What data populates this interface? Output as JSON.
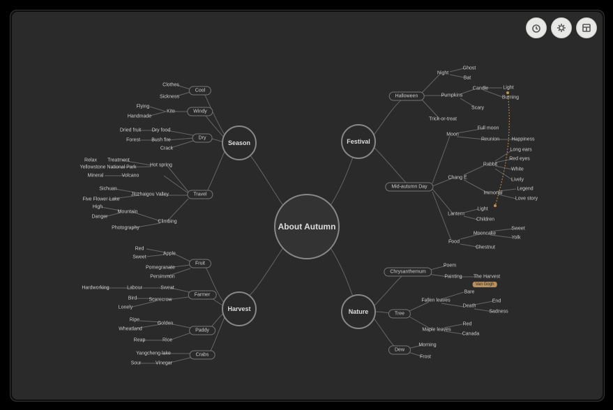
{
  "center": "About Autumn",
  "toolbar": {
    "timer": "timer-icon",
    "theme": "sun-icon",
    "layout": "layout-icon"
  },
  "branches": {
    "season": {
      "label": "Season",
      "children": {
        "cool": {
          "label": "Cool",
          "items": {
            "clothes": "Clothes",
            "sickness": "Sickness"
          }
        },
        "windy": {
          "label": "Windy",
          "items": {
            "kite": "Kite",
            "flying": "Flying",
            "handmade": "Handmade"
          }
        },
        "dry": {
          "label": "Dry",
          "items": {
            "dryfood": "Dry food",
            "driedfruit": "Dried fruit",
            "bushfire": "Bush fire",
            "forest": "Forest",
            "crack": "Crack"
          }
        },
        "travel": {
          "label": "Travel",
          "items": {
            "hotspring": "Hot spring",
            "relax": "Relax",
            "treatment": "Treatment",
            "yellowstone": "Yellowstone National Park",
            "volcano": "Volcano",
            "mineral": "Mineral",
            "jiuzhaigou": "Jiuzhaigou Valley",
            "sichuan": "Sichuan",
            "fiveflower": "Five Flower Lake",
            "climbing": "Climbing",
            "mountain": "Mountain",
            "high": "High",
            "danger": "Danger",
            "photography": "Photography"
          }
        }
      }
    },
    "harvest": {
      "label": "Harvest",
      "children": {
        "fruit": {
          "label": "Fruit",
          "items": {
            "apple": "Apple",
            "red": "Red",
            "sweet": "Sweet",
            "pomegranate": "Pomegranate",
            "persimmon": "Persimmon"
          }
        },
        "farmer": {
          "label": "Farmer",
          "items": {
            "sweat": "Sweat",
            "labour": "Labour",
            "hardworking": "Hardworking",
            "scarecrow": "Scarecrow",
            "bird": "Bird",
            "lonely": "Lonely"
          }
        },
        "paddy": {
          "label": "Paddy",
          "items": {
            "golden": "Golden",
            "ripe": "Ripe",
            "wheatland": "Wheatland",
            "rice": "Rice",
            "reap": "Reap"
          }
        },
        "crabs": {
          "label": "Crabs",
          "items": {
            "yangcheng": "Yangcheng lake",
            "vinegar": "Vinegar",
            "sour": "Sour"
          }
        }
      }
    },
    "festival": {
      "label": "Festival",
      "children": {
        "halloween": {
          "label": "Halloween",
          "items": {
            "night": "Night",
            "ghost": "Ghost",
            "bat": "Bat",
            "pumpkins": "Pumpkins",
            "candle": "Candle",
            "light": "Light",
            "burning": "Burning",
            "scary": "Scary",
            "trickortreat": "Trick-or-treat"
          }
        },
        "midautumn": {
          "label": "Mid-autumn Day",
          "items": {
            "moon": "Moon",
            "fullmoon": "Full moon",
            "reunion": "Reunion",
            "happiness": "Happiness",
            "change": "Chang E",
            "rabbit": "Rabbit",
            "longears": "Long ears",
            "redeyes": "Red eyes",
            "white": "White",
            "lively": "Lively",
            "immortal": "Immortal",
            "legend": "Legend",
            "lovestory": "Love story",
            "lantern": "Lantern",
            "lightL": "Light",
            "children": "Children",
            "food": "Food",
            "mooncake": "Mooncake",
            "sweetM": "Sweet",
            "yolk": "Yolk",
            "chestnut": "Chestnut"
          }
        }
      }
    },
    "nature": {
      "label": "Nature",
      "children": {
        "chrysanthemum": {
          "label": "Chrysanthemum",
          "items": {
            "poem": "Poem",
            "painting": "Painting",
            "theharvest": "The Harvest",
            "vangogh": "Van Gogh"
          }
        },
        "tree": {
          "label": "Tree",
          "items": {
            "fallenleaves": "Fallen leaves",
            "bare": "Bare",
            "death": "Death",
            "end": "End",
            "sadness": "Sadness",
            "mapleleaves": "Maple leaves",
            "redN": "Red",
            "canada": "Canada"
          }
        },
        "dew": {
          "label": "Dew",
          "items": {
            "morning": "Morning",
            "frost": "Frost"
          }
        }
      }
    }
  }
}
